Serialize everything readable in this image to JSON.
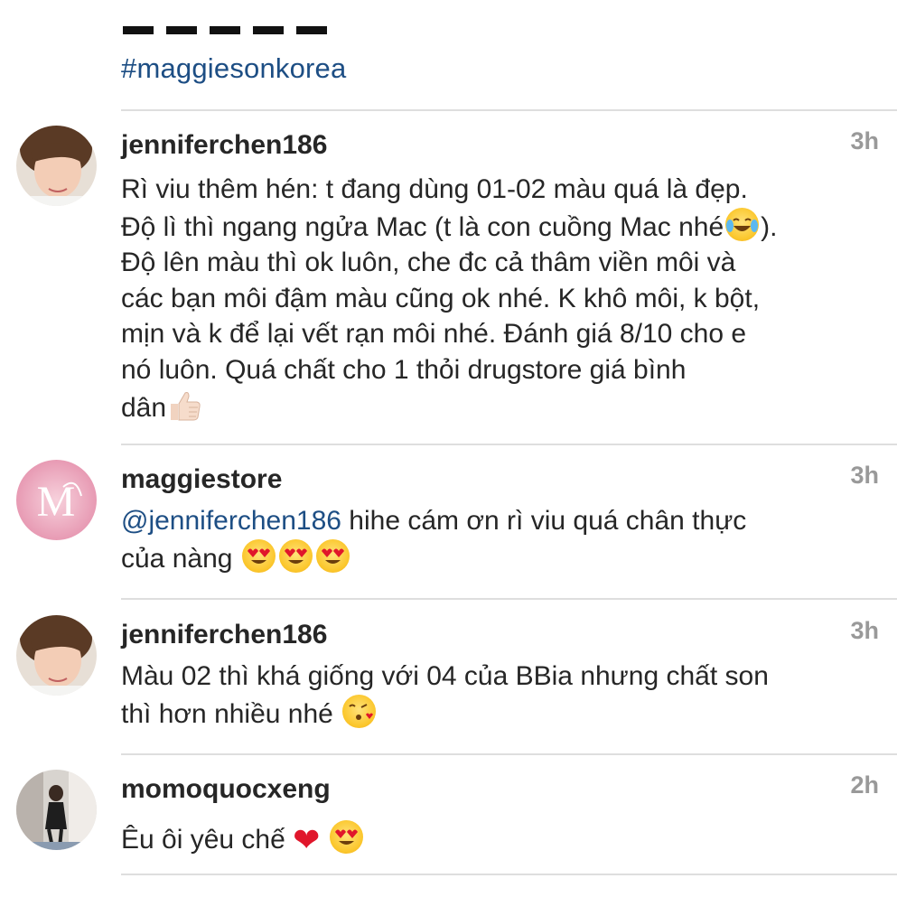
{
  "post": {
    "hashtag": "#maggiesonkorea"
  },
  "comments": [
    {
      "username": "jenniferchen186",
      "time": "3h",
      "lines": [
        "Rì viu thêm hén: t đang dùng 01-02 màu quá là đẹp.",
        "Độ lì thì ngang ngửa Mac (t là con cuồng Mac nhé",
        ").",
        "Độ lên màu thì ok luôn, che đc cả thâm viền môi và",
        "các bạn môi đậm màu cũng ok nhé. K khô môi, k bột,",
        "mịn và k để lại vết rạn môi nhé. Đánh giá 8/10 cho e",
        "nó luôn. Quá chất cho 1 thỏi drugstore giá bình",
        "dân"
      ],
      "emojis": [
        "face-with-tears-of-joy-emoji",
        "thumbs-up-emoji"
      ]
    },
    {
      "username": "maggiestore",
      "time": "3h",
      "mention": "@jenniferchen186",
      "lines": [
        " hihe cám ơn rì viu quá chân thực",
        "của nàng"
      ],
      "emojis": [
        "heart-eyes-emoji",
        "heart-eyes-emoji",
        "heart-eyes-emoji"
      ]
    },
    {
      "username": "jenniferchen186",
      "time": "3h",
      "lines": [
        "Màu 02 thì khá giống với 04 của BBia nhưng chất son",
        "thì hơn nhiều nhé"
      ],
      "emojis": [
        "face-blowing-kiss-emoji"
      ]
    },
    {
      "username": "momoquocxeng",
      "time": "2h",
      "lines": [
        "Êu ôi yêu chế"
      ],
      "emojis": [
        "red-heart-emoji",
        "heart-eyes-emoji"
      ]
    }
  ],
  "colors": {
    "link": "#1d4e84",
    "text": "#262626",
    "timestamp": "#999999",
    "divider": "#dedede",
    "brand_pink": "#e8a0b6"
  }
}
